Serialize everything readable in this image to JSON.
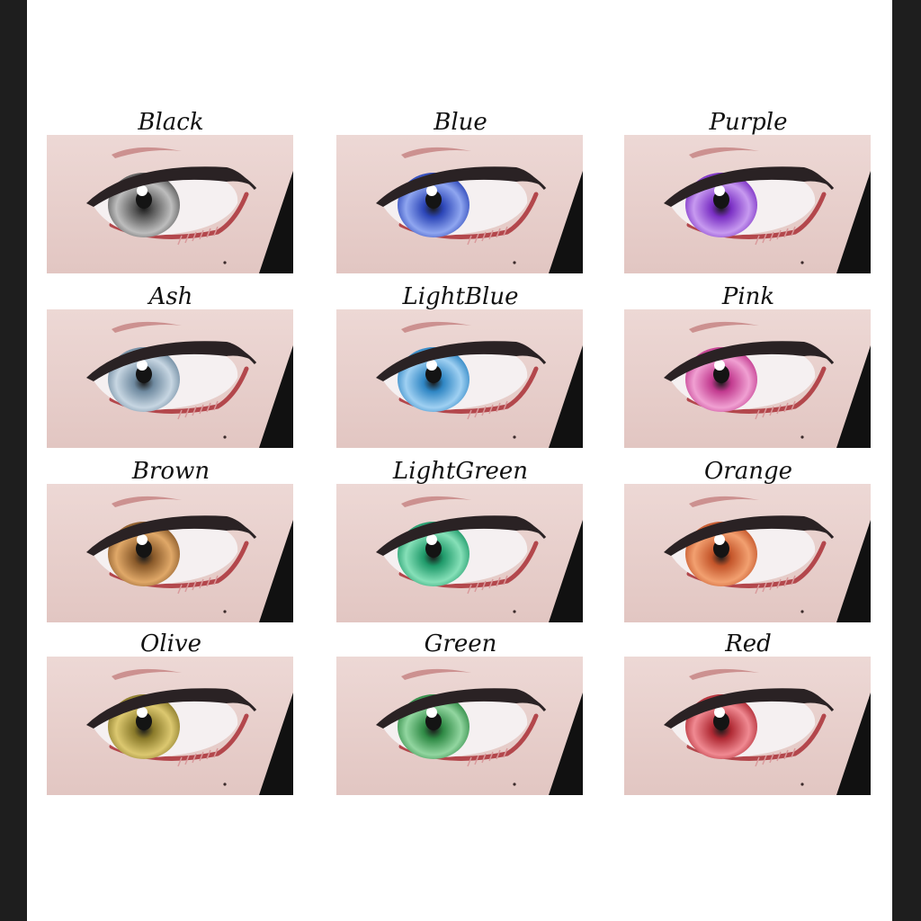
{
  "swatches": [
    {
      "label": "Black",
      "iris": "#5a5a5a",
      "glow": "#bdbdbd"
    },
    {
      "label": "Blue",
      "iris": "#2c46b8",
      "glow": "#8fa6f0"
    },
    {
      "label": "Purple",
      "iris": "#7a2fc4",
      "glow": "#c79af0"
    },
    {
      "label": "Ash",
      "iris": "#6f8aa0",
      "glow": "#c7d6e2"
    },
    {
      "label": "LightBlue",
      "iris": "#2f86c4",
      "glow": "#9fd0f2"
    },
    {
      "label": "Pink",
      "iris": "#c23a8f",
      "glow": "#f0a0d2"
    },
    {
      "label": "Brown",
      "iris": "#8a5a2a",
      "glow": "#e0a868"
    },
    {
      "label": "LightGreen",
      "iris": "#1f9a6a",
      "glow": "#86e0b8"
    },
    {
      "label": "Orange",
      "iris": "#c4552a",
      "glow": "#f2a070"
    },
    {
      "label": "Olive",
      "iris": "#8a7a2a",
      "glow": "#dcc870"
    },
    {
      "label": "Green",
      "iris": "#2f8a45",
      "glow": "#92d6a0"
    },
    {
      "label": "Red",
      "iris": "#b02a34",
      "glow": "#f08a92"
    }
  ]
}
